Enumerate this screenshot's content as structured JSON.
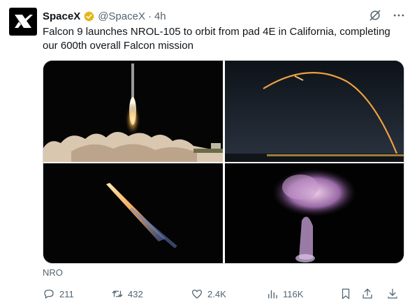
{
  "author": {
    "name": "SpaceX",
    "handle": "@SpaceX",
    "separator": "·",
    "time": "4h",
    "verified_color": "#e2b719"
  },
  "tweet": {
    "text": "Falcon 9 launches NROL-105 to orbit from pad 4E in California, completing our 600th overall Falcon mission"
  },
  "media_caption": "NRO",
  "media": [
    {
      "id": "photo-liftoff",
      "icon": "rocket-liftoff-image"
    },
    {
      "id": "photo-arc",
      "icon": "rocket-arc-image"
    },
    {
      "id": "photo-ascent",
      "icon": "rocket-ascent-image"
    },
    {
      "id": "photo-plume",
      "icon": "rocket-plume-image"
    }
  ],
  "actions": {
    "reply_count": "211",
    "retweet_count": "432",
    "like_count": "2.4K",
    "view_count": "116K"
  },
  "header_icons": [
    "grok-icon",
    "more-icon"
  ],
  "colors": {
    "muted": "#536471",
    "text": "#0f1419"
  }
}
